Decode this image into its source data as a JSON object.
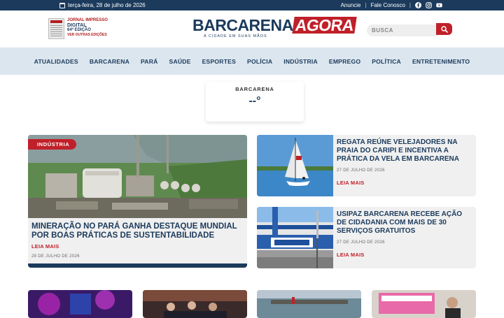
{
  "topbar": {
    "date": "terça-feira, 28 de julho de 2026",
    "links": [
      "Anuncie",
      "Fale Conosco"
    ],
    "separator": "|",
    "social_icons": [
      "facebook-icon",
      "instagram-icon",
      "youtube-icon"
    ]
  },
  "jornal": {
    "line1": "JORNAL IMPRESSO",
    "line2": "DIGITAL",
    "line3": "64ª EDIÇÃO",
    "line4": "VER OUTRAS EDIÇÕES"
  },
  "logo": {
    "part1": "BARCARENA",
    "part2": "AGORA",
    "tagline": "A CIDADE EM SUAS MÃOS"
  },
  "search": {
    "placeholder": "BUSCA"
  },
  "nav": {
    "items": [
      "ATUALIDADES",
      "BARCARENA",
      "PARÁ",
      "SAÚDE",
      "ESPORTES",
      "POLÍCIA",
      "INDÚSTRIA",
      "EMPREGO",
      "POLÍTICA",
      "ENTRETENIMENTO"
    ]
  },
  "weather": {
    "city": "BARCARENA",
    "temp": "--°"
  },
  "featured": {
    "badge": "INDÚSTRIA",
    "title": "MINERAÇÃO NO PARÁ GANHA DESTAQUE MUNDIAL POR BOAS PRÁTICAS DE SUSTENTABILIDADE",
    "read_more": "LEIA MAIS",
    "date": "28 DE JULHO DE 2026"
  },
  "cards": [
    {
      "title": "REGATA REÚNE VELEJADORES NA PRAIA DO CARIPI E INCENTIVA A PRÁTICA DA VELA EM BARCARENA",
      "date": "27 DE JULHO DE 2026",
      "read_more": "LEIA MAIS"
    },
    {
      "title": "USIPAZ BARCARENA RECEBE AÇÃO DE CIDADANIA COM MAIS DE 30 SERVIÇOS GRATUITOS",
      "date": "27 DE JULHO DE 2026",
      "read_more": "LEIA MAIS"
    }
  ],
  "colors": {
    "primary": "#1b3a5c",
    "accent": "#c0202a",
    "nav_bg": "#dce6ef"
  }
}
